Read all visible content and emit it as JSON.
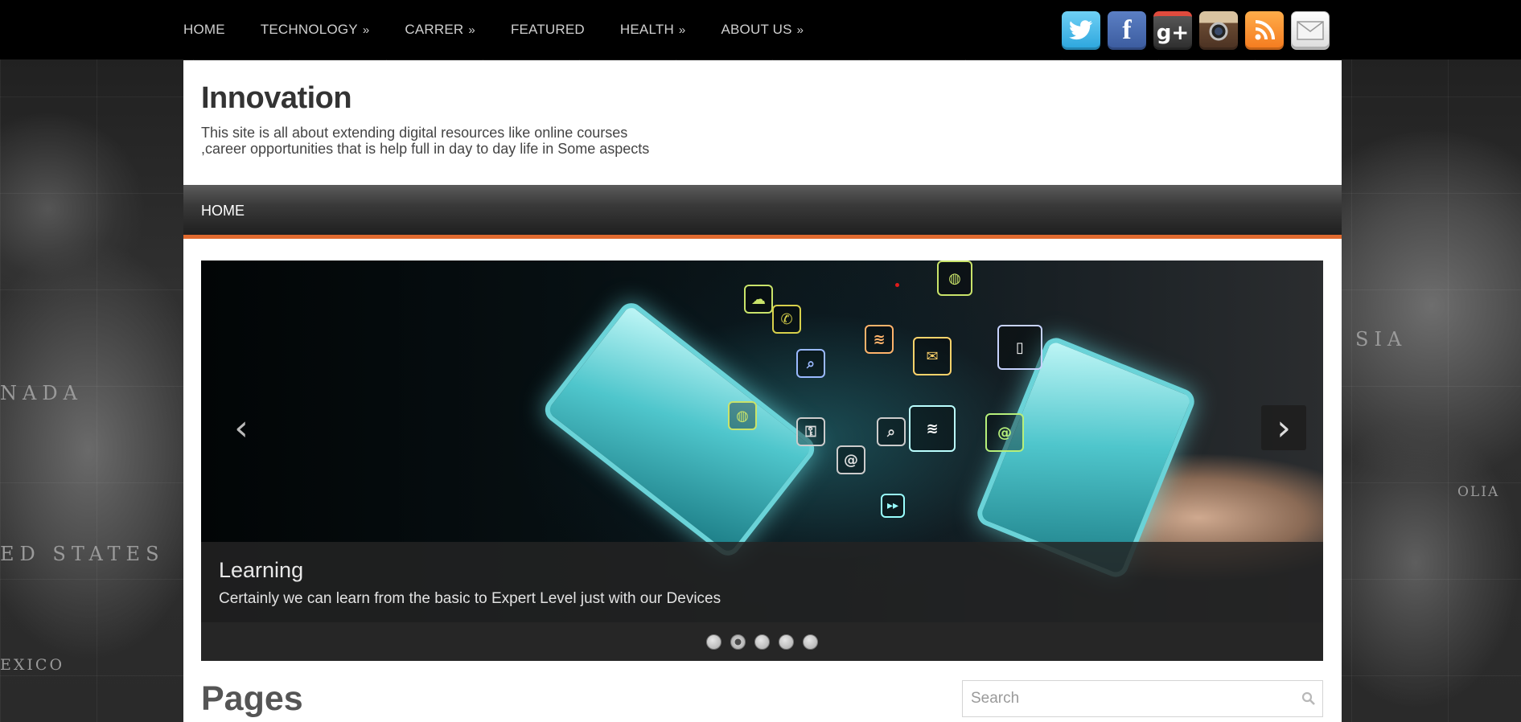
{
  "top_nav": {
    "items": [
      {
        "label": "HOME",
        "has_submenu": false
      },
      {
        "label": "TECHNOLOGY",
        "has_submenu": true
      },
      {
        "label": "CARRER",
        "has_submenu": true
      },
      {
        "label": "FEATURED",
        "has_submenu": false
      },
      {
        "label": "HEALTH",
        "has_submenu": true
      },
      {
        "label": "ABOUT US",
        "has_submenu": true
      }
    ],
    "submenu_glyph": "»"
  },
  "social_icons": [
    "twitter-icon",
    "facebook-icon",
    "google-plus-icon",
    "instagram-icon",
    "rss-icon",
    "email-icon"
  ],
  "header": {
    "title": "Innovation",
    "tagline_line1": "This site is all about extending digital resources like online courses",
    "tagline_line2": ",career opportunities that is help full in day to day life in Some aspects"
  },
  "main_nav": {
    "home_label": "HOME",
    "accent_color": "#e0692e"
  },
  "slider": {
    "caption_title": "Learning",
    "caption_text": "Certainly we can learn from the basic to Expert Level just with our Devices",
    "slide_count": 5,
    "active_index": 1,
    "prev_glyph": "‹",
    "next_glyph": "›"
  },
  "content": {
    "heading": "Pages"
  },
  "search": {
    "placeholder": "Search"
  }
}
